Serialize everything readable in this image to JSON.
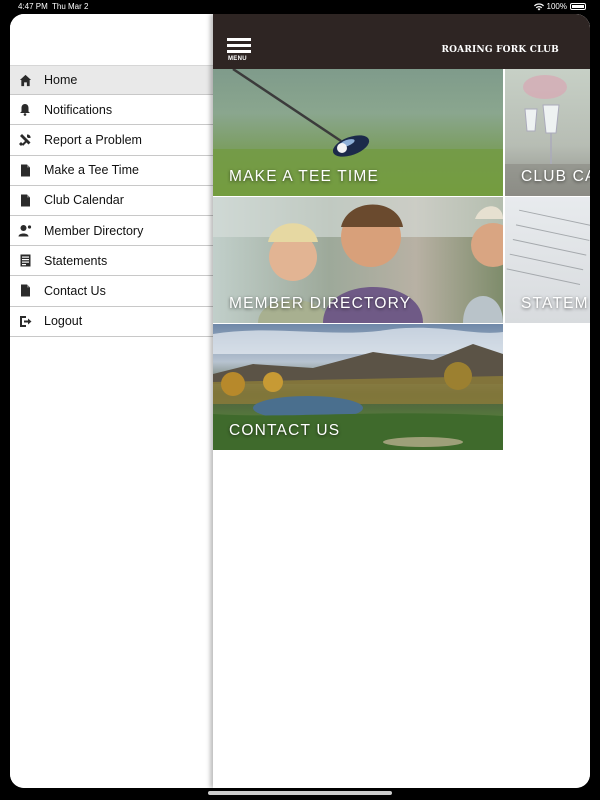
{
  "status": {
    "time": "4:47 PM",
    "date": "Thu Mar 2",
    "battery": "100%"
  },
  "sidebar": {
    "items": [
      {
        "label": "Home",
        "icon": "home-icon",
        "active": true
      },
      {
        "label": "Notifications",
        "icon": "bell-icon"
      },
      {
        "label": "Report a Problem",
        "icon": "tools-icon"
      },
      {
        "label": "Make a Tee Time",
        "icon": "document-icon"
      },
      {
        "label": "Club Calendar",
        "icon": "document-icon"
      },
      {
        "label": "Member Directory",
        "icon": "person-icon"
      },
      {
        "label": "Statements",
        "icon": "statement-icon"
      },
      {
        "label": "Contact Us",
        "icon": "document-icon"
      },
      {
        "label": "Logout",
        "icon": "logout-icon"
      }
    ]
  },
  "header": {
    "menu_label": "MENU",
    "brand": "ROARING FORK CLUB",
    "background": "#2e2523"
  },
  "tiles": {
    "tee_time": "MAKE A TEE TIME",
    "club_calendar": "CLUB CA",
    "member_directory": "MEMBER DIRECTORY",
    "statements": "STATEM",
    "contact_us": "CONTACT US"
  }
}
